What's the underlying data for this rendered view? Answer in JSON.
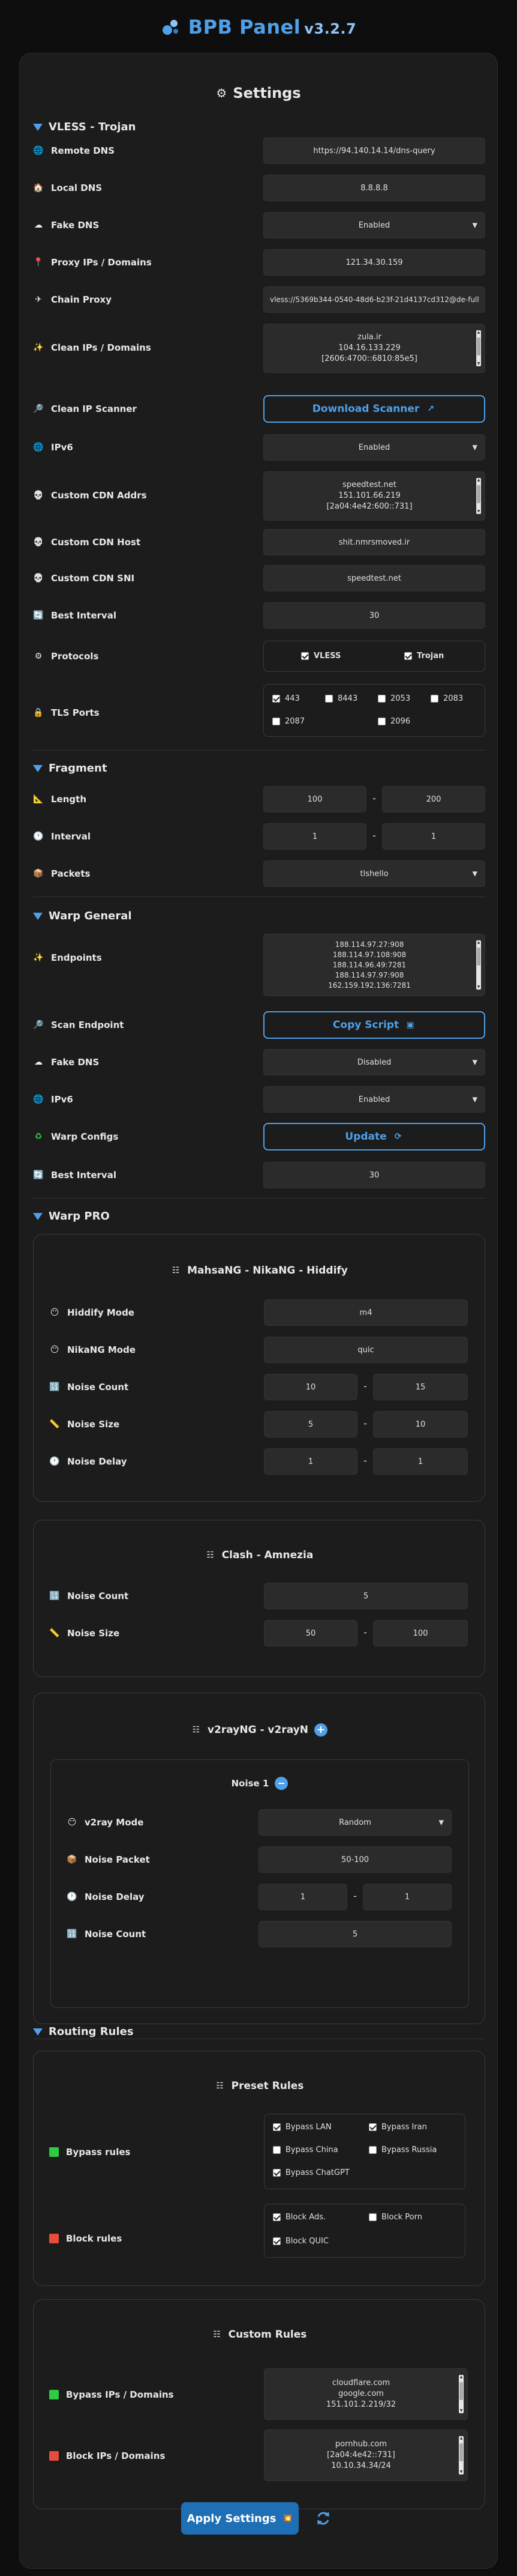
{
  "header": {
    "title": "BPB Panel",
    "version": "v3.2.7"
  },
  "settings_title": "Settings",
  "vless_trojan": {
    "title": "VLESS - Trojan",
    "remote_dns": {
      "label": "Remote DNS",
      "value": "https://94.140.14.14/dns-query"
    },
    "local_dns": {
      "label": "Local DNS",
      "value": "8.8.8.8"
    },
    "fake_dns": {
      "label": "Fake DNS",
      "value": "Enabled"
    },
    "proxy_ips": {
      "label": "Proxy IPs / Domains",
      "value": "121.34.30.159"
    },
    "chain_proxy": {
      "label": "Chain Proxy",
      "value": "vless://5369b344-0540-48d6-b23f-21d4137cd312@de-full"
    },
    "clean_ips": {
      "label": "Clean IPs / Domains",
      "lines": [
        "zula.ir",
        "104.16.133.229",
        "[2606:4700::6810:85e5]"
      ]
    },
    "clean_ip_scanner": {
      "label": "Clean IP Scanner",
      "button": "Download Scanner"
    },
    "ipv6": {
      "label": "IPv6",
      "value": "Enabled"
    },
    "custom_cdn_addrs": {
      "label": "Custom CDN Addrs",
      "lines": [
        "speedtest.net",
        "151.101.66.219",
        "[2a04:4e42:600::731]"
      ]
    },
    "custom_cdn_host": {
      "label": "Custom CDN Host",
      "value": "shit.nmrsmoved.ir"
    },
    "custom_cdn_sni": {
      "label": "Custom CDN SNI",
      "value": "speedtest.net"
    },
    "best_interval": {
      "label": "Best Interval",
      "value": "30"
    },
    "protocols": {
      "label": "Protocols",
      "options": [
        {
          "label": "VLESS",
          "checked": true
        },
        {
          "label": "Trojan",
          "checked": true
        }
      ]
    },
    "tls_ports": {
      "label": "TLS Ports",
      "ports": [
        {
          "label": "443",
          "checked": true
        },
        {
          "label": "8443",
          "checked": false
        },
        {
          "label": "2053",
          "checked": false
        },
        {
          "label": "2083",
          "checked": false
        },
        {
          "label": "2087",
          "checked": false
        },
        {
          "label": "2096",
          "checked": false
        }
      ]
    }
  },
  "fragment": {
    "title": "Fragment",
    "length": {
      "label": "Length",
      "min": "100",
      "max": "200"
    },
    "interval": {
      "label": "Interval",
      "min": "1",
      "max": "1"
    },
    "packets": {
      "label": "Packets",
      "value": "tlshello"
    }
  },
  "warp_general": {
    "title": "Warp General",
    "endpoints": {
      "label": "Endpoints",
      "lines": [
        "188.114.97.27:908",
        "188.114.97.108:908",
        "188.114.96.49:7281",
        "188.114.97.97:908",
        "162.159.192.136:7281"
      ]
    },
    "scan_endpoint": {
      "label": "Scan Endpoint",
      "button": "Copy Script"
    },
    "fake_dns": {
      "label": "Fake DNS",
      "value": "Disabled"
    },
    "ipv6": {
      "label": "IPv6",
      "value": "Enabled"
    },
    "warp_configs": {
      "label": "Warp Configs",
      "button": "Update"
    },
    "best_interval": {
      "label": "Best Interval",
      "value": "30"
    }
  },
  "warp_pro": {
    "title": "Warp PRO",
    "hiddify": {
      "title": "MahsaNG - NikaNG - Hiddify",
      "hiddify_mode": {
        "label": "Hiddify Mode",
        "value": "m4"
      },
      "nikang_mode": {
        "label": "NikaNG Mode",
        "value": "quic"
      },
      "noise_count": {
        "label": "Noise Count",
        "min": "10",
        "max": "15"
      },
      "noise_size": {
        "label": "Noise Size",
        "min": "5",
        "max": "10"
      },
      "noise_delay": {
        "label": "Noise Delay",
        "min": "1",
        "max": "1"
      }
    },
    "clash": {
      "title": "Clash - Amnezia",
      "noise_count": {
        "label": "Noise Count",
        "value": "5"
      },
      "noise_size": {
        "label": "Noise Size",
        "min": "50",
        "max": "100"
      }
    },
    "v2ray": {
      "title": "v2rayNG - v2rayN",
      "noise1": {
        "title": "Noise 1",
        "mode": {
          "label": "v2ray Mode",
          "value": "Random"
        },
        "packet": {
          "label": "Noise Packet",
          "value": "50-100"
        },
        "delay": {
          "label": "Noise Delay",
          "min": "1",
          "max": "1"
        },
        "count": {
          "label": "Noise Count",
          "value": "5"
        }
      }
    }
  },
  "routing": {
    "title": "Routing Rules",
    "preset": {
      "title": "Preset Rules",
      "bypass": {
        "label": "Bypass rules",
        "options": [
          {
            "label": "Bypass LAN",
            "checked": true
          },
          {
            "label": "Bypass Iran",
            "checked": true
          },
          {
            "label": "Bypass China",
            "checked": false
          },
          {
            "label": "Bypass Russia",
            "checked": false
          },
          {
            "label": "Bypass ChatGPT",
            "checked": true
          }
        ]
      },
      "block": {
        "label": "Block rules",
        "options": [
          {
            "label": "Block Ads.",
            "checked": true
          },
          {
            "label": "Block Porn",
            "checked": false
          },
          {
            "label": "Block QUIC",
            "checked": true
          }
        ]
      }
    },
    "custom": {
      "title": "Custom Rules",
      "bypass": {
        "label": "Bypass IPs / Domains",
        "lines": [
          "cloudflare.com",
          "google.com",
          "151.101.2.219/32"
        ]
      },
      "block": {
        "label": "Block IPs / Domains",
        "lines": [
          "pornhub.com",
          "[2a04:4e42::731]",
          "10.10.34.34/24"
        ]
      }
    }
  },
  "apply_label": "Apply Settings",
  "colors": {
    "accent": "#4ea0e8",
    "bypass": "#2ecc40",
    "block": "#e74c3c"
  }
}
